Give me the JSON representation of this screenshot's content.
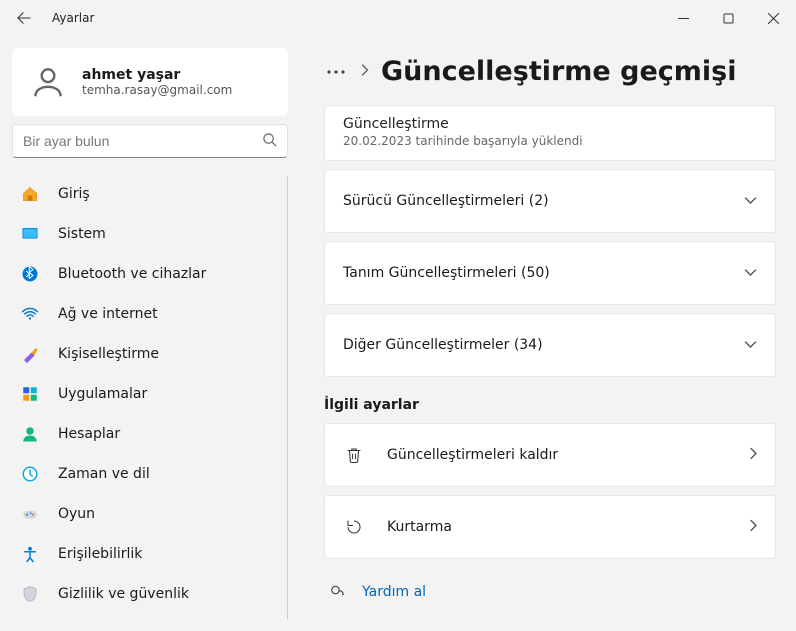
{
  "titlebar": {
    "title": "Ayarlar"
  },
  "profile": {
    "name": "ahmet yaşar",
    "email": "temha.rasay@gmail.com"
  },
  "search": {
    "placeholder": "Bir ayar bulun"
  },
  "nav": [
    {
      "icon": "home",
      "label": "Giriş"
    },
    {
      "icon": "system",
      "label": "Sistem"
    },
    {
      "icon": "bluetooth",
      "label": "Bluetooth ve cihazlar"
    },
    {
      "icon": "wifi",
      "label": "Ağ ve internet"
    },
    {
      "icon": "personalize",
      "label": "Kişiselleştirme"
    },
    {
      "icon": "apps",
      "label": "Uygulamalar"
    },
    {
      "icon": "accounts",
      "label": "Hesaplar"
    },
    {
      "icon": "time",
      "label": "Zaman ve dil"
    },
    {
      "icon": "gaming",
      "label": "Oyun"
    },
    {
      "icon": "accessibility",
      "label": "Erişilebilirlik"
    },
    {
      "icon": "privacy",
      "label": "Gizlilik ve güvenlik"
    }
  ],
  "page": {
    "title": "Güncelleştirme geçmişi",
    "info_card": {
      "title": "Güncelleştirme",
      "subtitle": "20.02.2023 tarihinde başarıyla yüklendi"
    },
    "accordions": [
      {
        "label": "Sürücü Güncelleştirmeleri (2)"
      },
      {
        "label": "Tanım Güncelleştirmeleri (50)"
      },
      {
        "label": "Diğer Güncelleştirmeler (34)"
      }
    ],
    "related_heading": "İlgili ayarlar",
    "related": [
      {
        "icon": "trash",
        "label": "Güncelleştirmeleri kaldır"
      },
      {
        "icon": "recovery",
        "label": "Kurtarma"
      }
    ],
    "help_label": "Yardım al"
  }
}
